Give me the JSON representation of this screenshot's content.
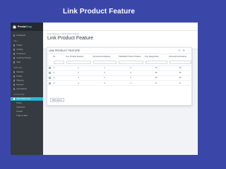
{
  "page_heading": "Link Product Feature",
  "sidebar": {
    "logo_prefix": "Presta",
    "logo_suffix": "Shop",
    "top_items": [
      {
        "label": "Dashboard"
      }
    ],
    "sections": [
      {
        "title": "Sell",
        "items": [
          {
            "label": "Orders"
          },
          {
            "label": "Catalog"
          },
          {
            "label": "Customers"
          },
          {
            "label": "Customer Service"
          },
          {
            "label": "Stats"
          }
        ]
      },
      {
        "title": "Improve",
        "items": [
          {
            "label": "Modules"
          },
          {
            "label": "Design"
          },
          {
            "label": "Shipping"
          },
          {
            "label": "Payment"
          },
          {
            "label": "International"
          }
        ]
      },
      {
        "title": "Configure",
        "items": [
          {
            "label": "Shop Parameters"
          },
          {
            "label": "Orders"
          },
          {
            "label": "Customers"
          },
          {
            "label": "Contact"
          },
          {
            "label": "Traffic & SEO"
          }
        ]
      }
    ],
    "active_label": "Shop Parameters"
  },
  "breadcrumb": "Link Features / Link Product Feature",
  "module_title": "Link Product Feature",
  "panel": {
    "title": "LINK PRODUCT FEATURE",
    "icons": [
      "refresh-icon",
      "settings-icon",
      "more-icon"
    ],
    "columns": [
      "ID",
      "Key Product Feature",
      "Dimensional Feature",
      "Tradeable Product Feature",
      "Key Designation",
      "Dimensional Feature"
    ],
    "rows": [
      {
        "id": "1",
        "c1": "1",
        "c2": "1",
        "c3": "1",
        "c4": "16",
        "c5": "16"
      },
      {
        "id": "2",
        "c1": "2",
        "c2": "2",
        "c3": "2",
        "c4": "28",
        "c5": "28"
      },
      {
        "id": "3",
        "c1": "3",
        "c2": "3",
        "c3": "3",
        "c4": "36",
        "c5": "36"
      },
      {
        "id": "4",
        "c1": "4",
        "c2": "4",
        "c3": "4",
        "c4": "8",
        "c5": "8"
      }
    ],
    "bulk_label": "Bulk actions"
  }
}
